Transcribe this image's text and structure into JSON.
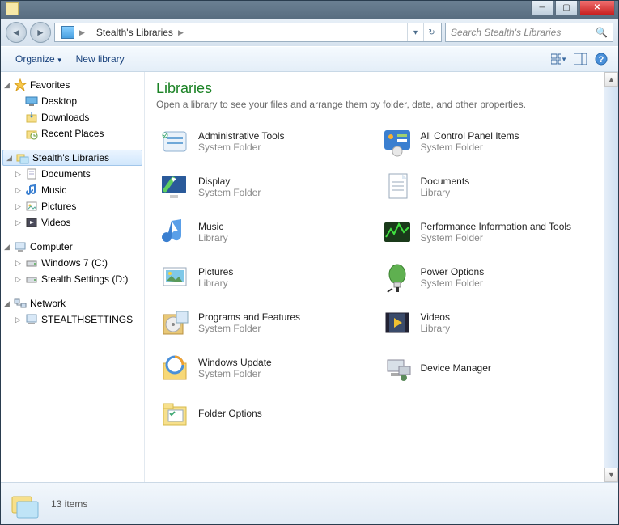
{
  "titlebar": {
    "app_icon": "libraries-icon"
  },
  "nav": {
    "breadcrumb": [
      {
        "label": "Stealth's Libraries",
        "icon": "libraries-icon"
      }
    ],
    "search_placeholder": "Search Stealth's Libraries"
  },
  "toolbar": {
    "organize_label": "Organize",
    "newlib_label": "New library"
  },
  "sidebar": {
    "groups": [
      {
        "label": "Favorites",
        "icon": "star-icon",
        "open": true,
        "children": [
          {
            "label": "Desktop",
            "icon": "desktop-icon"
          },
          {
            "label": "Downloads",
            "icon": "downloads-icon"
          },
          {
            "label": "Recent Places",
            "icon": "recent-icon"
          }
        ]
      },
      {
        "label": "Stealth's Libraries",
        "icon": "libraries-icon",
        "open": true,
        "selected": true,
        "children": [
          {
            "label": "Documents",
            "icon": "doc-icon",
            "expandable": true
          },
          {
            "label": "Music",
            "icon": "music-icon",
            "expandable": true
          },
          {
            "label": "Pictures",
            "icon": "pic-icon",
            "expandable": true
          },
          {
            "label": "Videos",
            "icon": "vid-icon",
            "expandable": true
          }
        ]
      },
      {
        "label": "Computer",
        "icon": "computer-icon",
        "open": true,
        "children": [
          {
            "label": "Windows 7 (C:)",
            "icon": "drive-icon",
            "expandable": true
          },
          {
            "label": "Stealth Settings (D:)",
            "icon": "drive-icon",
            "expandable": true
          }
        ]
      },
      {
        "label": "Network",
        "icon": "network-icon",
        "open": true,
        "children": [
          {
            "label": "STEALTHSETTINGS",
            "icon": "pc-icon",
            "expandable": true
          }
        ]
      }
    ]
  },
  "main": {
    "title": "Libraries",
    "subtitle": "Open a library to see your files and arrange them by folder, date, and other properties.",
    "items": [
      {
        "name": "Administrative Tools",
        "sub": "System Folder",
        "icon": "admintools"
      },
      {
        "name": "All Control Panel Items",
        "sub": "System Folder",
        "icon": "controlpanel"
      },
      {
        "name": "Display",
        "sub": "System Folder",
        "icon": "display"
      },
      {
        "name": "Documents",
        "sub": "Library",
        "icon": "documents"
      },
      {
        "name": "Music",
        "sub": "Library",
        "icon": "music"
      },
      {
        "name": "Performance Information and Tools",
        "sub": "System Folder",
        "icon": "perf"
      },
      {
        "name": "Pictures",
        "sub": "Library",
        "icon": "pictures"
      },
      {
        "name": "Power Options",
        "sub": "System Folder",
        "icon": "power"
      },
      {
        "name": "Programs and Features",
        "sub": "System Folder",
        "icon": "programs"
      },
      {
        "name": "Videos",
        "sub": "Library",
        "icon": "videos"
      },
      {
        "name": "Windows Update",
        "sub": "System Folder",
        "icon": "update"
      },
      {
        "name": "Device Manager",
        "sub": "",
        "icon": "devmgr"
      },
      {
        "name": "Folder Options",
        "sub": "",
        "icon": "folderopt"
      }
    ]
  },
  "status": {
    "count_label": "13 items"
  }
}
